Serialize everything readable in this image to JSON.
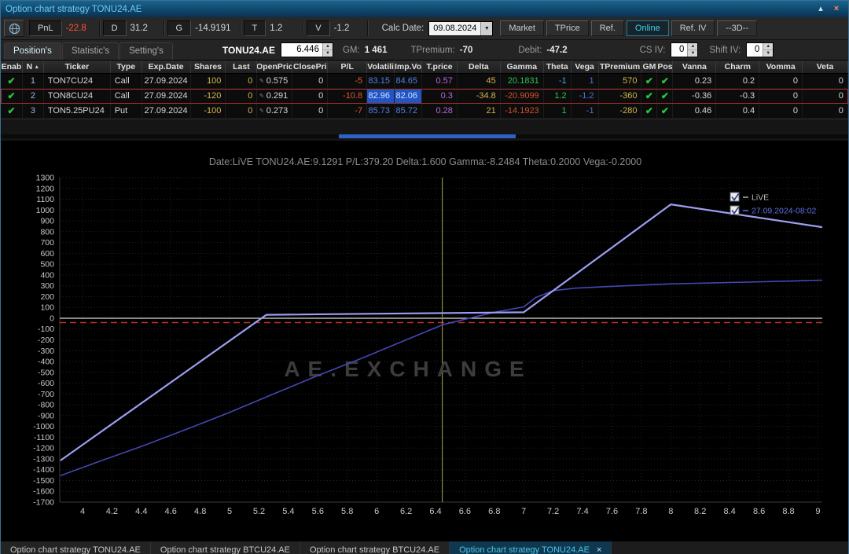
{
  "titlebar": {
    "title": "Option chart strategy TONU24.AE"
  },
  "icons": {
    "collapse": "▴",
    "close": "×",
    "dropdown": "▼",
    "spin_up": "▲",
    "spin_down": "▼",
    "check": "✔",
    "edit": "✎",
    "sort_asc": "▲",
    "tab_close": "×"
  },
  "toolbar": {
    "stats": [
      {
        "label": "PnL",
        "value": "-22.8",
        "value_color": "#ff5040"
      },
      {
        "label": "D",
        "value": "31.2",
        "value_color": "#d8d8d8"
      },
      {
        "label": "G",
        "value": "-14.9191",
        "value_color": "#d8d8d8"
      },
      {
        "label": "T",
        "value": "1.2",
        "value_color": "#d8d8d8"
      },
      {
        "label": "V",
        "value": "-1.2",
        "value_color": "#d8d8d8"
      }
    ],
    "calc_date_label": "Calc Date:",
    "calc_date_value": "09.08.2024",
    "buttons": [
      {
        "label": "Market",
        "active": false
      },
      {
        "label": "TPrice",
        "active": false
      },
      {
        "label": "Ref.",
        "active": false
      },
      {
        "label": "Online",
        "active": true
      },
      {
        "label": "Ref. IV",
        "active": false
      },
      {
        "label": "--3D--",
        "active": false
      }
    ]
  },
  "subtoolbar": {
    "tabs": [
      {
        "label": "Position's",
        "active": true
      },
      {
        "label": "Statistic's",
        "active": false
      },
      {
        "label": "Setting's",
        "active": false
      }
    ],
    "symbol": "TONU24.AE",
    "symbol_price": "6.446",
    "gm_label": "GM:",
    "gm_value": "1 461",
    "tpremium_label": "TPremium:",
    "tpremium_value": "-70",
    "debit_label": "Debit:",
    "debit_value": "-47.2",
    "cs_iv_label": "CS IV:",
    "cs_iv_value": "0",
    "shift_iv_label": "Shift IV:",
    "shift_iv_value": "0"
  },
  "positions_table": {
    "columns": [
      "Enab",
      "N",
      "Ticker",
      "Type",
      "Exp.Date",
      "Shares",
      "Last",
      "OpenPric",
      "ClosePri",
      "P/L",
      "Volatili",
      "Imp.Vo",
      "T.price",
      "Delta",
      "Gamma",
      "Theta",
      "Vega",
      "TPremium",
      "GM",
      "Pos",
      "Vanna",
      "Charm",
      "Vomma",
      "Veta"
    ],
    "sort_column": 1,
    "rows": [
      {
        "selected": false,
        "enabled": true,
        "n": "1",
        "ticker": "TON7CU24",
        "type": "Call",
        "exp_date": "27.09.2024",
        "shares": "100",
        "last": "0",
        "open_price": "0.575",
        "close_price": "0",
        "pl": "-5",
        "volatility": "83.15",
        "imp_vol": "84.65",
        "t_price": "0.57",
        "delta": "45",
        "gamma": "20.1831",
        "theta": "-1",
        "vega": "1",
        "tpremium": "570",
        "gm": true,
        "pos": true,
        "vanna": "0.23",
        "charm": "0.2",
        "vomma": "0",
        "veta": "0"
      },
      {
        "selected": true,
        "enabled": true,
        "n": "2",
        "ticker": "TON8CU24",
        "type": "Call",
        "exp_date": "27.09.2024",
        "shares": "-120",
        "last": "0",
        "open_price": "0.291",
        "close_price": "0",
        "pl": "-10.8",
        "volatility": "82.96",
        "imp_vol": "82.06",
        "t_price": "0.3",
        "delta": "-34.8",
        "gamma": "-20.9099",
        "theta": "1.2",
        "vega": "-1.2",
        "tpremium": "-360",
        "gm": true,
        "pos": true,
        "vanna": "-0.36",
        "charm": "-0.3",
        "vomma": "0",
        "veta": "0"
      },
      {
        "selected": false,
        "enabled": true,
        "n": "3",
        "ticker": "TON5.25PU24",
        "type": "Put",
        "exp_date": "27.09.2024",
        "shares": "-100",
        "last": "0",
        "open_price": "0.273",
        "close_price": "0",
        "pl": "-7",
        "volatility": "85.73",
        "imp_vol": "85.72",
        "t_price": "0.28",
        "delta": "21",
        "gamma": "-14.1923",
        "theta": "1",
        "vega": "-1",
        "tpremium": "-280",
        "gm": true,
        "pos": true,
        "vanna": "0.46",
        "charm": "0.4",
        "vomma": "0",
        "veta": "0"
      }
    ]
  },
  "chart_data": {
    "type": "line",
    "title": "Date:LiVE  TONU24.AE:9.1291  P/L:379.20  Delta:1.600  Gamma:-8.2484  Theta:0.2000  Vega:-0.2000",
    "watermark": "AE.EXCHANGE",
    "xlim": [
      3.845,
      9.03
    ],
    "ylim": [
      -1700,
      1300
    ],
    "y_tick_step": 100,
    "x_ticks": [
      4,
      4.2,
      4.4,
      4.6,
      4.8,
      5,
      5.2,
      5.4,
      5.6,
      5.8,
      6,
      6.2,
      6.4,
      6.6,
      6.8,
      7,
      7.2,
      7.4,
      7.6,
      7.8,
      8,
      8.2,
      8.4,
      8.6,
      8.8,
      9
    ],
    "grid": true,
    "current_price_line": 6.446,
    "zero_line_level": 0,
    "red_dash_level": -40,
    "legend_position": "top-right",
    "legend": [
      {
        "label": "LiVE",
        "checked": true,
        "text_color": "#b8b8b8",
        "marker_color": "#b0b0b0"
      },
      {
        "label": "27.09.2024-08:02",
        "checked": true,
        "text_color": "#5b6fe0",
        "marker_color": "#5b6fe0"
      }
    ],
    "series": [
      {
        "name": "LiVE",
        "color": "#4547b4",
        "width": 1.6,
        "points": [
          [
            3.85,
            -1455
          ],
          [
            4.1,
            -1330
          ],
          [
            4.4,
            -1185
          ],
          [
            4.7,
            -1030
          ],
          [
            5.0,
            -870
          ],
          [
            5.3,
            -700
          ],
          [
            5.6,
            -530
          ],
          [
            5.9,
            -370
          ],
          [
            6.2,
            -200
          ],
          [
            6.45,
            -60
          ],
          [
            6.6,
            -10
          ],
          [
            6.8,
            55
          ],
          [
            7.0,
            105
          ],
          [
            7.08,
            190
          ],
          [
            7.2,
            255
          ],
          [
            7.35,
            278
          ],
          [
            7.6,
            295
          ],
          [
            8.0,
            318
          ],
          [
            8.4,
            330
          ],
          [
            8.7,
            340
          ],
          [
            9.03,
            352
          ]
        ]
      },
      {
        "name": "27.09.2024-08:02",
        "color": "#9d9ef2",
        "width": 2.2,
        "points": [
          [
            3.85,
            -1315
          ],
          [
            5.25,
            32
          ],
          [
            7.0,
            55
          ],
          [
            8.0,
            1052
          ],
          [
            9.03,
            842
          ]
        ]
      }
    ]
  },
  "bottom_tabs": [
    {
      "label": "Option chart strategy TONU24.AE",
      "active": false,
      "closable": false
    },
    {
      "label": "Option chart strategy BTCU24.AE",
      "active": false,
      "closable": false
    },
    {
      "label": "Option chart strategy BTCU24.AE",
      "active": false,
      "closable": false
    },
    {
      "label": "Option chart strategy TONU24.AE",
      "active": true,
      "closable": true
    }
  ]
}
